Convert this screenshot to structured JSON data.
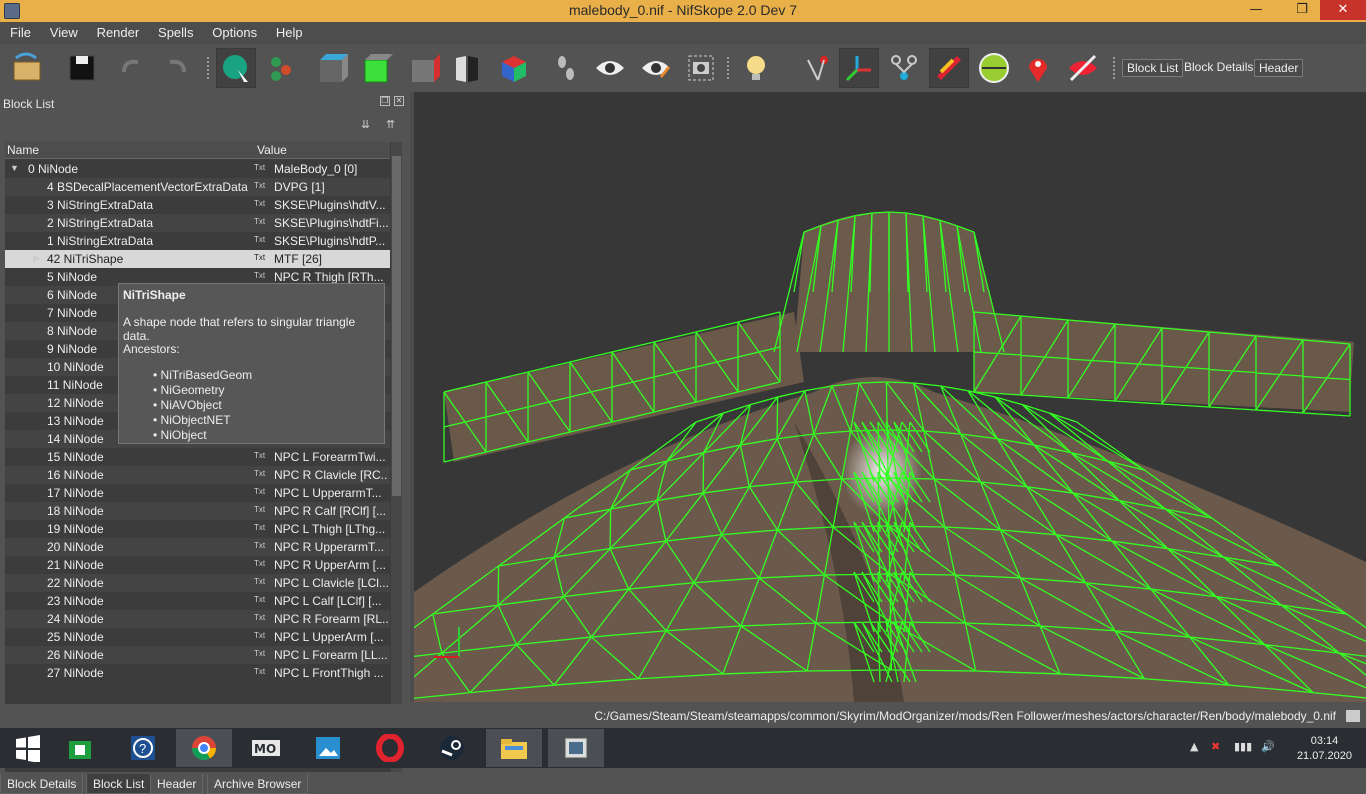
{
  "window": {
    "title": "malebody_0.nif - NifSkope 2.0 Dev 7",
    "minimize": "—",
    "maximize": "❐",
    "close": "✕"
  },
  "menu": [
    "File",
    "View",
    "Render",
    "Spells",
    "Options",
    "Help"
  ],
  "toolbar": {
    "block_list": "Block List",
    "block_details": "Block Details",
    "header": "Header"
  },
  "dock": {
    "title": "Block List",
    "col_name": "Name",
    "col_value": "Value",
    "txt_tag": "Txt"
  },
  "tree": [
    {
      "name": "0 NiNode",
      "value": "MaleBody_0 [0]",
      "indent": 0,
      "expanded": true
    },
    {
      "name": "4 BSDecalPlacementVectorExtraData",
      "value": "DVPG [1]",
      "indent": 1
    },
    {
      "name": "3 NiStringExtraData",
      "value": "SKSE\\Plugins\\hdtV...",
      "indent": 1
    },
    {
      "name": "2 NiStringExtraData",
      "value": "SKSE\\Plugins\\hdtFi...",
      "indent": 1
    },
    {
      "name": "1 NiStringExtraData",
      "value": "SKSE\\Plugins\\hdtP...",
      "indent": 1
    },
    {
      "name": "42 NiTriShape",
      "value": "MTF [26]",
      "indent": 1,
      "selected": true,
      "collapsed": true
    },
    {
      "name": "5 NiNode",
      "value": "NPC R Thigh [RTh...",
      "indent": 1
    },
    {
      "name": "6 NiNode",
      "value": "",
      "indent": 1
    },
    {
      "name": "7 NiNode",
      "value": "",
      "indent": 1
    },
    {
      "name": "8 NiNode",
      "value": "",
      "indent": 1
    },
    {
      "name": "9 NiNode",
      "value": "",
      "indent": 1
    },
    {
      "name": "10 NiNode",
      "value": "",
      "indent": 1
    },
    {
      "name": "11 NiNode",
      "value": "",
      "indent": 1
    },
    {
      "name": "12 NiNode",
      "value": "",
      "indent": 1
    },
    {
      "name": "13 NiNode",
      "value": "",
      "indent": 1
    },
    {
      "name": "14 NiNode",
      "value": "",
      "indent": 1
    },
    {
      "name": "15 NiNode",
      "value": "NPC L ForearmTwi...",
      "indent": 1
    },
    {
      "name": "16 NiNode",
      "value": "NPC R Clavicle [RC...",
      "indent": 1
    },
    {
      "name": "17 NiNode",
      "value": "NPC L UpperarmT...",
      "indent": 1
    },
    {
      "name": "18 NiNode",
      "value": "NPC R Calf [RClf] [...",
      "indent": 1
    },
    {
      "name": "19 NiNode",
      "value": "NPC L Thigh [LThg...",
      "indent": 1
    },
    {
      "name": "20 NiNode",
      "value": "NPC R UpperarmT...",
      "indent": 1
    },
    {
      "name": "21 NiNode",
      "value": "NPC R UpperArm [...",
      "indent": 1
    },
    {
      "name": "22 NiNode",
      "value": "NPC L Clavicle [LCl...",
      "indent": 1
    },
    {
      "name": "23 NiNode",
      "value": "NPC L Calf [LClf] [...",
      "indent": 1
    },
    {
      "name": "24 NiNode",
      "value": "NPC R Forearm [RL...",
      "indent": 1
    },
    {
      "name": "25 NiNode",
      "value": "NPC L UpperArm [...",
      "indent": 1
    },
    {
      "name": "26 NiNode",
      "value": "NPC L Forearm [LL...",
      "indent": 1
    },
    {
      "name": "27 NiNode",
      "value": "NPC L FrontThigh ...",
      "indent": 1
    }
  ],
  "tooltip": {
    "title": "NiTriShape",
    "description": "A shape node that refers to singular triangle data.",
    "ancestors_label": "Ancestors:",
    "ancestors": [
      "NiTriBasedGeom",
      "NiGeometry",
      "NiAVObject",
      "NiObjectNET",
      "NiObject"
    ]
  },
  "tabs": [
    "Block Details",
    "Block List",
    "Header",
    "Archive Browser"
  ],
  "active_tab": "Block List",
  "status": {
    "path": "C:/Games/Steam/Steam/steamapps/common/Skyrim/ModOrganizer/mods/Ren Follower/meshes/actors/character/Ren/body/malebody_0.nif"
  },
  "taskbar": {
    "time": "03:14",
    "date": "21.07.2020"
  },
  "colors": {
    "titlebar": "#e9b04a",
    "wireframe": "#33ff22",
    "skin": "#6b5a4c",
    "viewport_bg": "#373737"
  }
}
